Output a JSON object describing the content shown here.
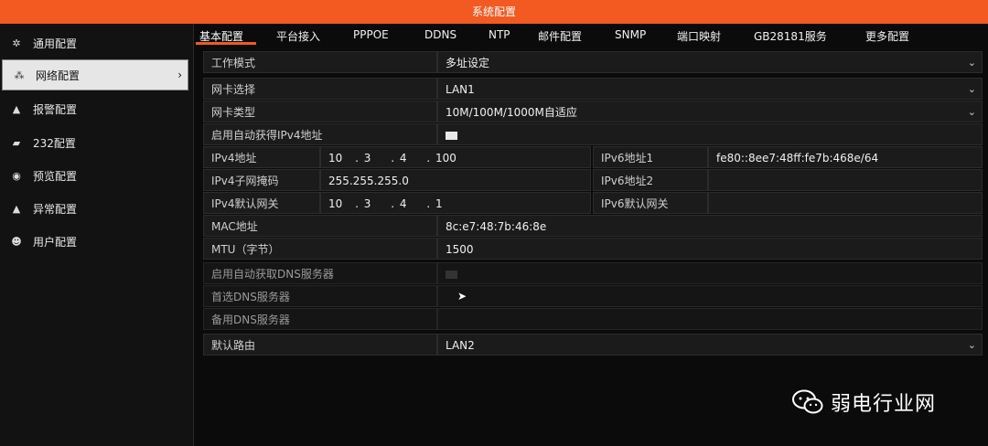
{
  "window": {
    "title": "系统配置"
  },
  "sidebar": {
    "items": [
      {
        "label": "通用配置",
        "icon": "gear-icon"
      },
      {
        "label": "网络配置",
        "icon": "network-icon",
        "active": true
      },
      {
        "label": "报警配置",
        "icon": "alarm-icon"
      },
      {
        "label": "232配置",
        "icon": "serial-port-icon"
      },
      {
        "label": "预览配置",
        "icon": "eye-icon"
      },
      {
        "label": "异常配置",
        "icon": "warning-icon"
      },
      {
        "label": "用户配置",
        "icon": "users-icon"
      }
    ]
  },
  "tabs": [
    "基本配置",
    "平台接入",
    "PPPOE",
    "DDNS",
    "NTP",
    "邮件配置",
    "SNMP",
    "端口映射",
    "GB28181服务",
    "更多配置"
  ],
  "form": {
    "work_mode": {
      "label": "工作模式",
      "value": "多址设定"
    },
    "nic_select": {
      "label": "网卡选择",
      "value": "LAN1"
    },
    "nic_type": {
      "label": "网卡类型",
      "value": "10M/100M/1000M自适应"
    },
    "dhcp_ipv4": {
      "label": "启用自动获得IPv4地址",
      "checked": true
    },
    "ipv4_address": {
      "label": "IPv4地址",
      "octets": [
        "10",
        "3",
        "4",
        "100"
      ]
    },
    "ipv4_mask": {
      "label": "IPv4子网掩码",
      "octets": [
        "255",
        "255",
        "255",
        "0"
      ]
    },
    "ipv4_gateway": {
      "label": "IPv4默认网关",
      "octets": [
        "10",
        "3",
        "4",
        "1"
      ]
    },
    "ipv6_address1": {
      "label": "IPv6地址1",
      "value": "fe80::8ee7:48ff:fe7b:468e/64"
    },
    "ipv6_address2": {
      "label": "IPv6地址2",
      "value": ""
    },
    "ipv6_gateway": {
      "label": "IPv6默认网关",
      "value": ""
    },
    "mac_address": {
      "label": "MAC地址",
      "value": "8c:e7:48:7b:46:8e"
    },
    "mtu": {
      "label": "MTU（字节）",
      "value": "1500"
    },
    "dhcp_dns": {
      "label": "启用自动获取DNS服务器",
      "checked": false
    },
    "preferred_dns": {
      "label": "首选DNS服务器",
      "value": ""
    },
    "alternate_dns": {
      "label": "备用DNS服务器",
      "value": ""
    },
    "default_route": {
      "label": "默认路由",
      "value": "LAN2"
    }
  },
  "watermark": {
    "text": "弱电行业网"
  },
  "colors": {
    "accent": "#f25a22",
    "background": "#0b0b0b",
    "cell": "#1b1b1b"
  }
}
